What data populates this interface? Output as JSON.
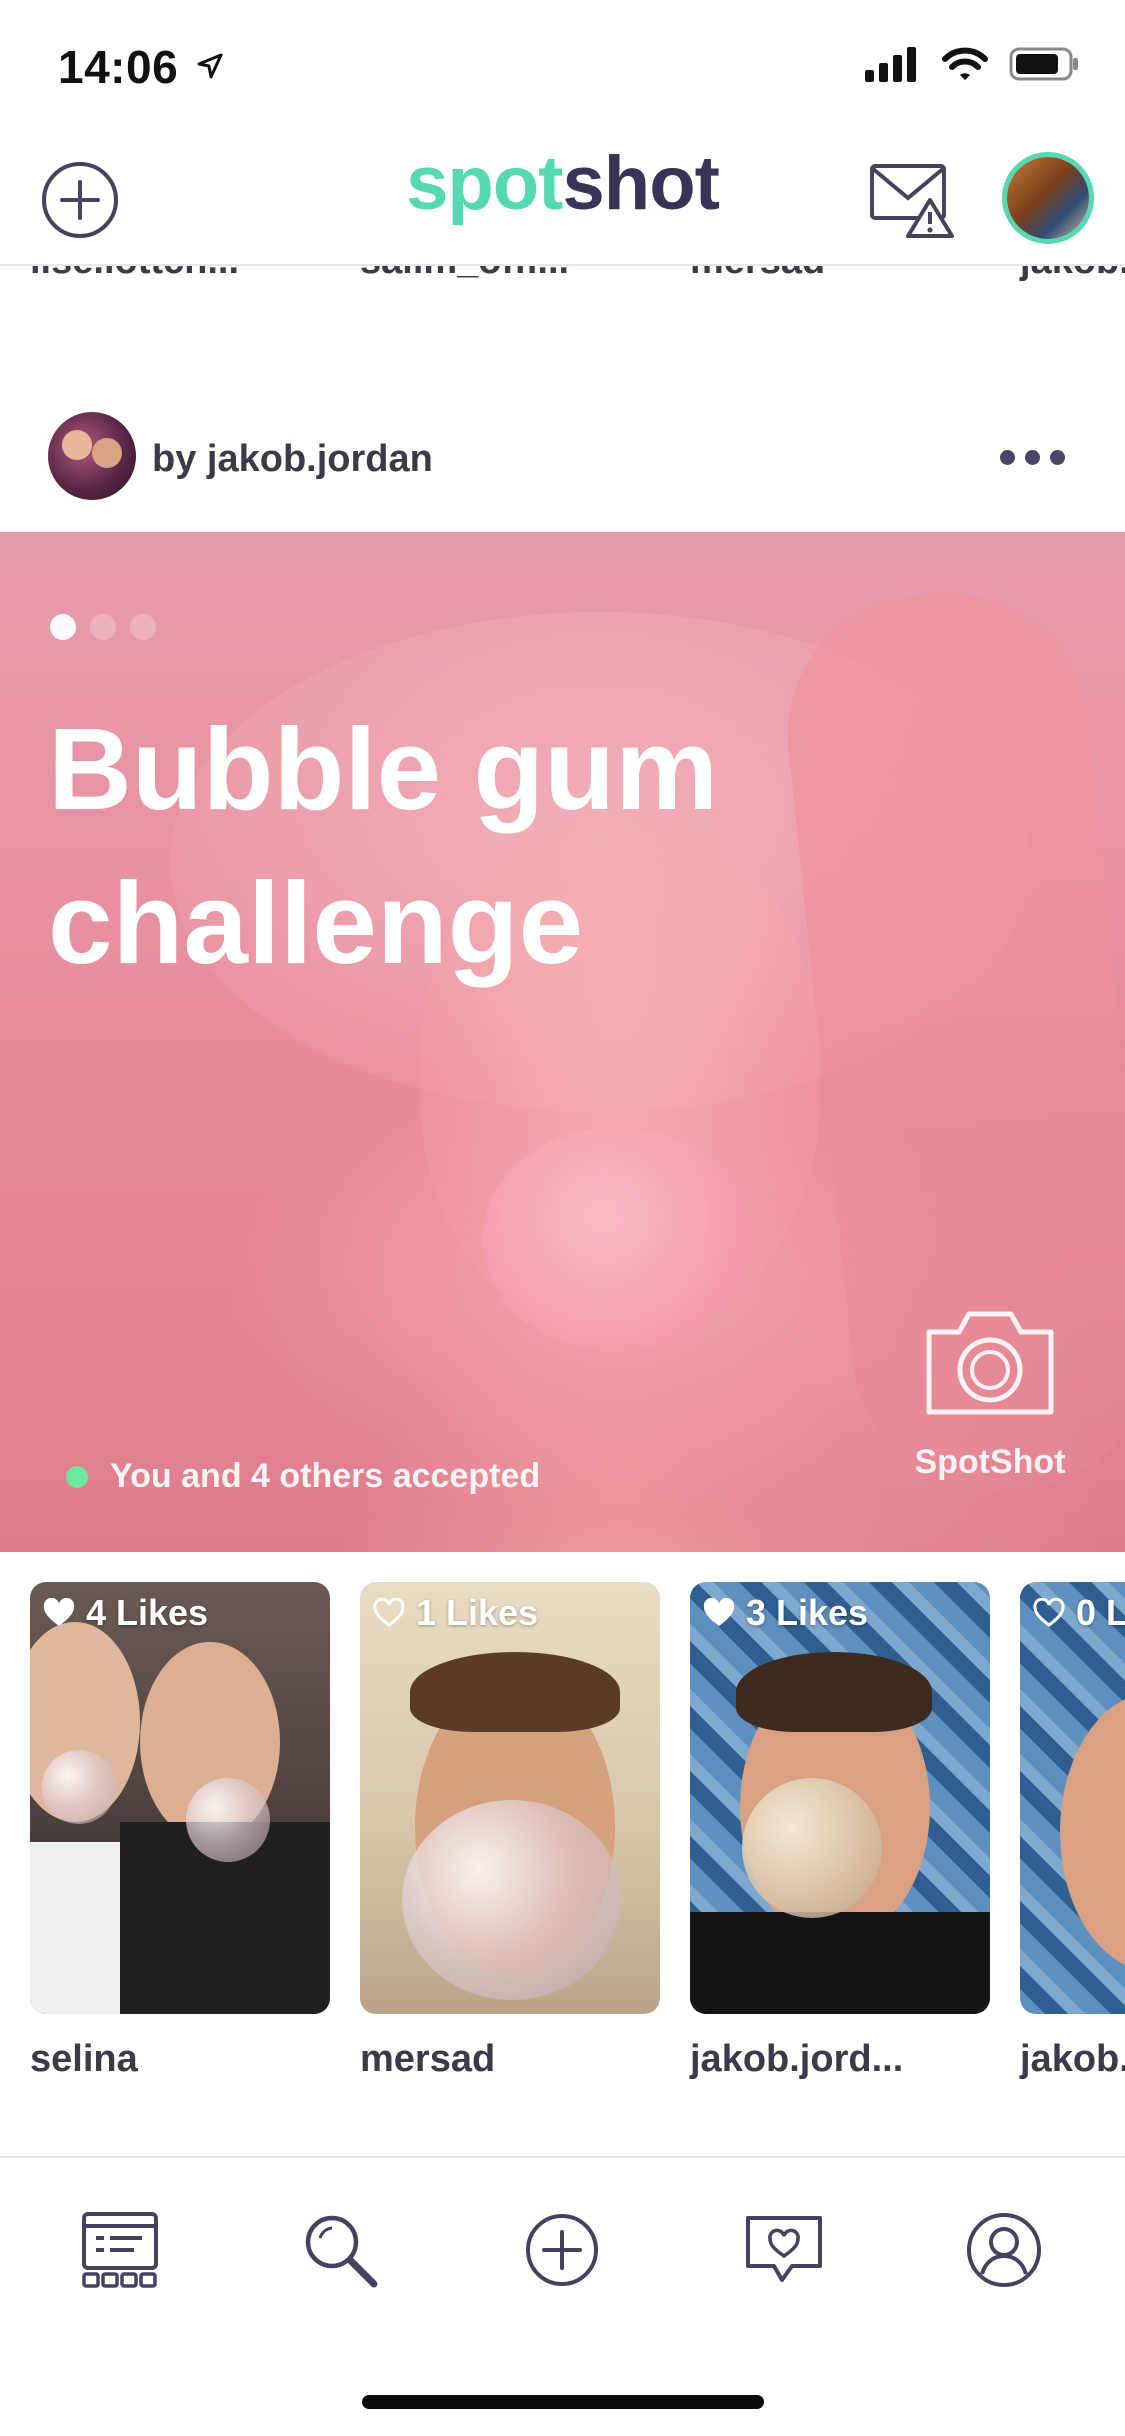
{
  "status_bar": {
    "time": "14:06"
  },
  "header": {
    "logo_part1": "spot",
    "logo_part2": "shot"
  },
  "top_strip": {
    "users": [
      "lise.lottch...",
      "salim_offi...",
      "mersad",
      "jakob."
    ]
  },
  "post": {
    "author_line": "by jakob.jordan",
    "title": "Bubble gum challenge",
    "accepted_text": "You and 4 others accepted",
    "spotshot_label": "SpotShot",
    "carousel": {
      "count": 3,
      "active": 0
    }
  },
  "responses": [
    {
      "likes": "4 Likes",
      "liked": true,
      "name": "selina"
    },
    {
      "likes": "1 Likes",
      "liked": false,
      "name": "mersad"
    },
    {
      "likes": "3 Likes",
      "liked": true,
      "name": "jakob.jord..."
    },
    {
      "likes": "0 L",
      "liked": false,
      "name": "jakob."
    }
  ],
  "bottom_nav": [
    "feed-icon",
    "search-icon",
    "add-icon",
    "messages-heart-icon",
    "profile-icon"
  ],
  "colors": {
    "brand_green": "#56d9b2",
    "brand_purple": "#3a3358",
    "accepted_dot": "#6ee7a0"
  }
}
